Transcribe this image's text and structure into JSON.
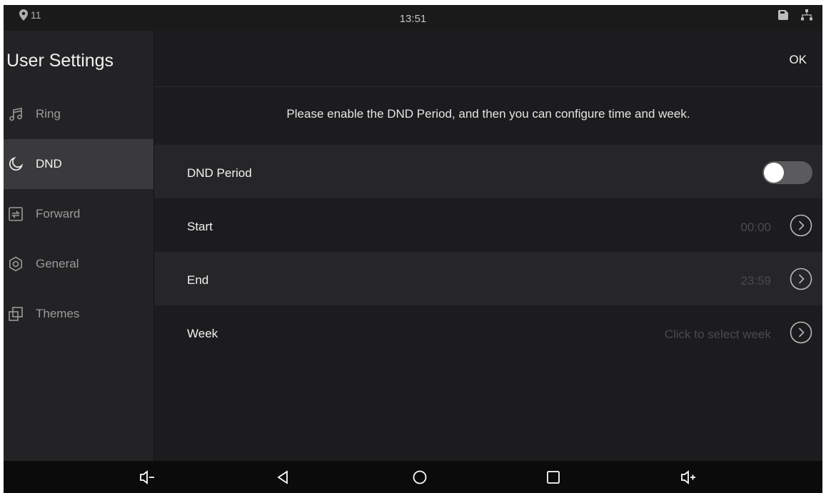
{
  "status_bar": {
    "location_icon": "location-pin-icon",
    "location_count": "11",
    "time": "13:51",
    "right_icons": [
      "sd-card-icon",
      "network-icon"
    ]
  },
  "sidebar": {
    "title": "User Settings",
    "items": [
      {
        "label": "Ring",
        "icon": "music-note-icon",
        "active": false
      },
      {
        "label": "DND",
        "icon": "moon-icon",
        "active": true
      },
      {
        "label": "Forward",
        "icon": "forward-icon",
        "active": false
      },
      {
        "label": "General",
        "icon": "gear-icon",
        "active": false
      },
      {
        "label": "Themes",
        "icon": "themes-icon",
        "active": false
      }
    ]
  },
  "main": {
    "ok_label": "OK",
    "notice": "Please enable the DND Period, and then you can configure time and week.",
    "rows": [
      {
        "label": "DND Period",
        "type": "toggle",
        "enabled": false
      },
      {
        "label": "Start",
        "value": "00:00",
        "type": "chevron"
      },
      {
        "label": "End",
        "value": "23:59",
        "type": "chevron"
      },
      {
        "label": "Week",
        "value": "Click to select week",
        "type": "chevron"
      }
    ]
  },
  "nav_bar": {
    "buttons": [
      "volume-down-icon",
      "back-icon",
      "home-icon",
      "recents-icon",
      "volume-up-icon"
    ]
  },
  "colors": {
    "background": "#1c1c1e",
    "sidebar": "#232325",
    "active_item": "#3a3a3c",
    "row_shade": "#262628",
    "disabled_text": "#4a4a4c",
    "toggle_track": "#5b5b5d"
  }
}
